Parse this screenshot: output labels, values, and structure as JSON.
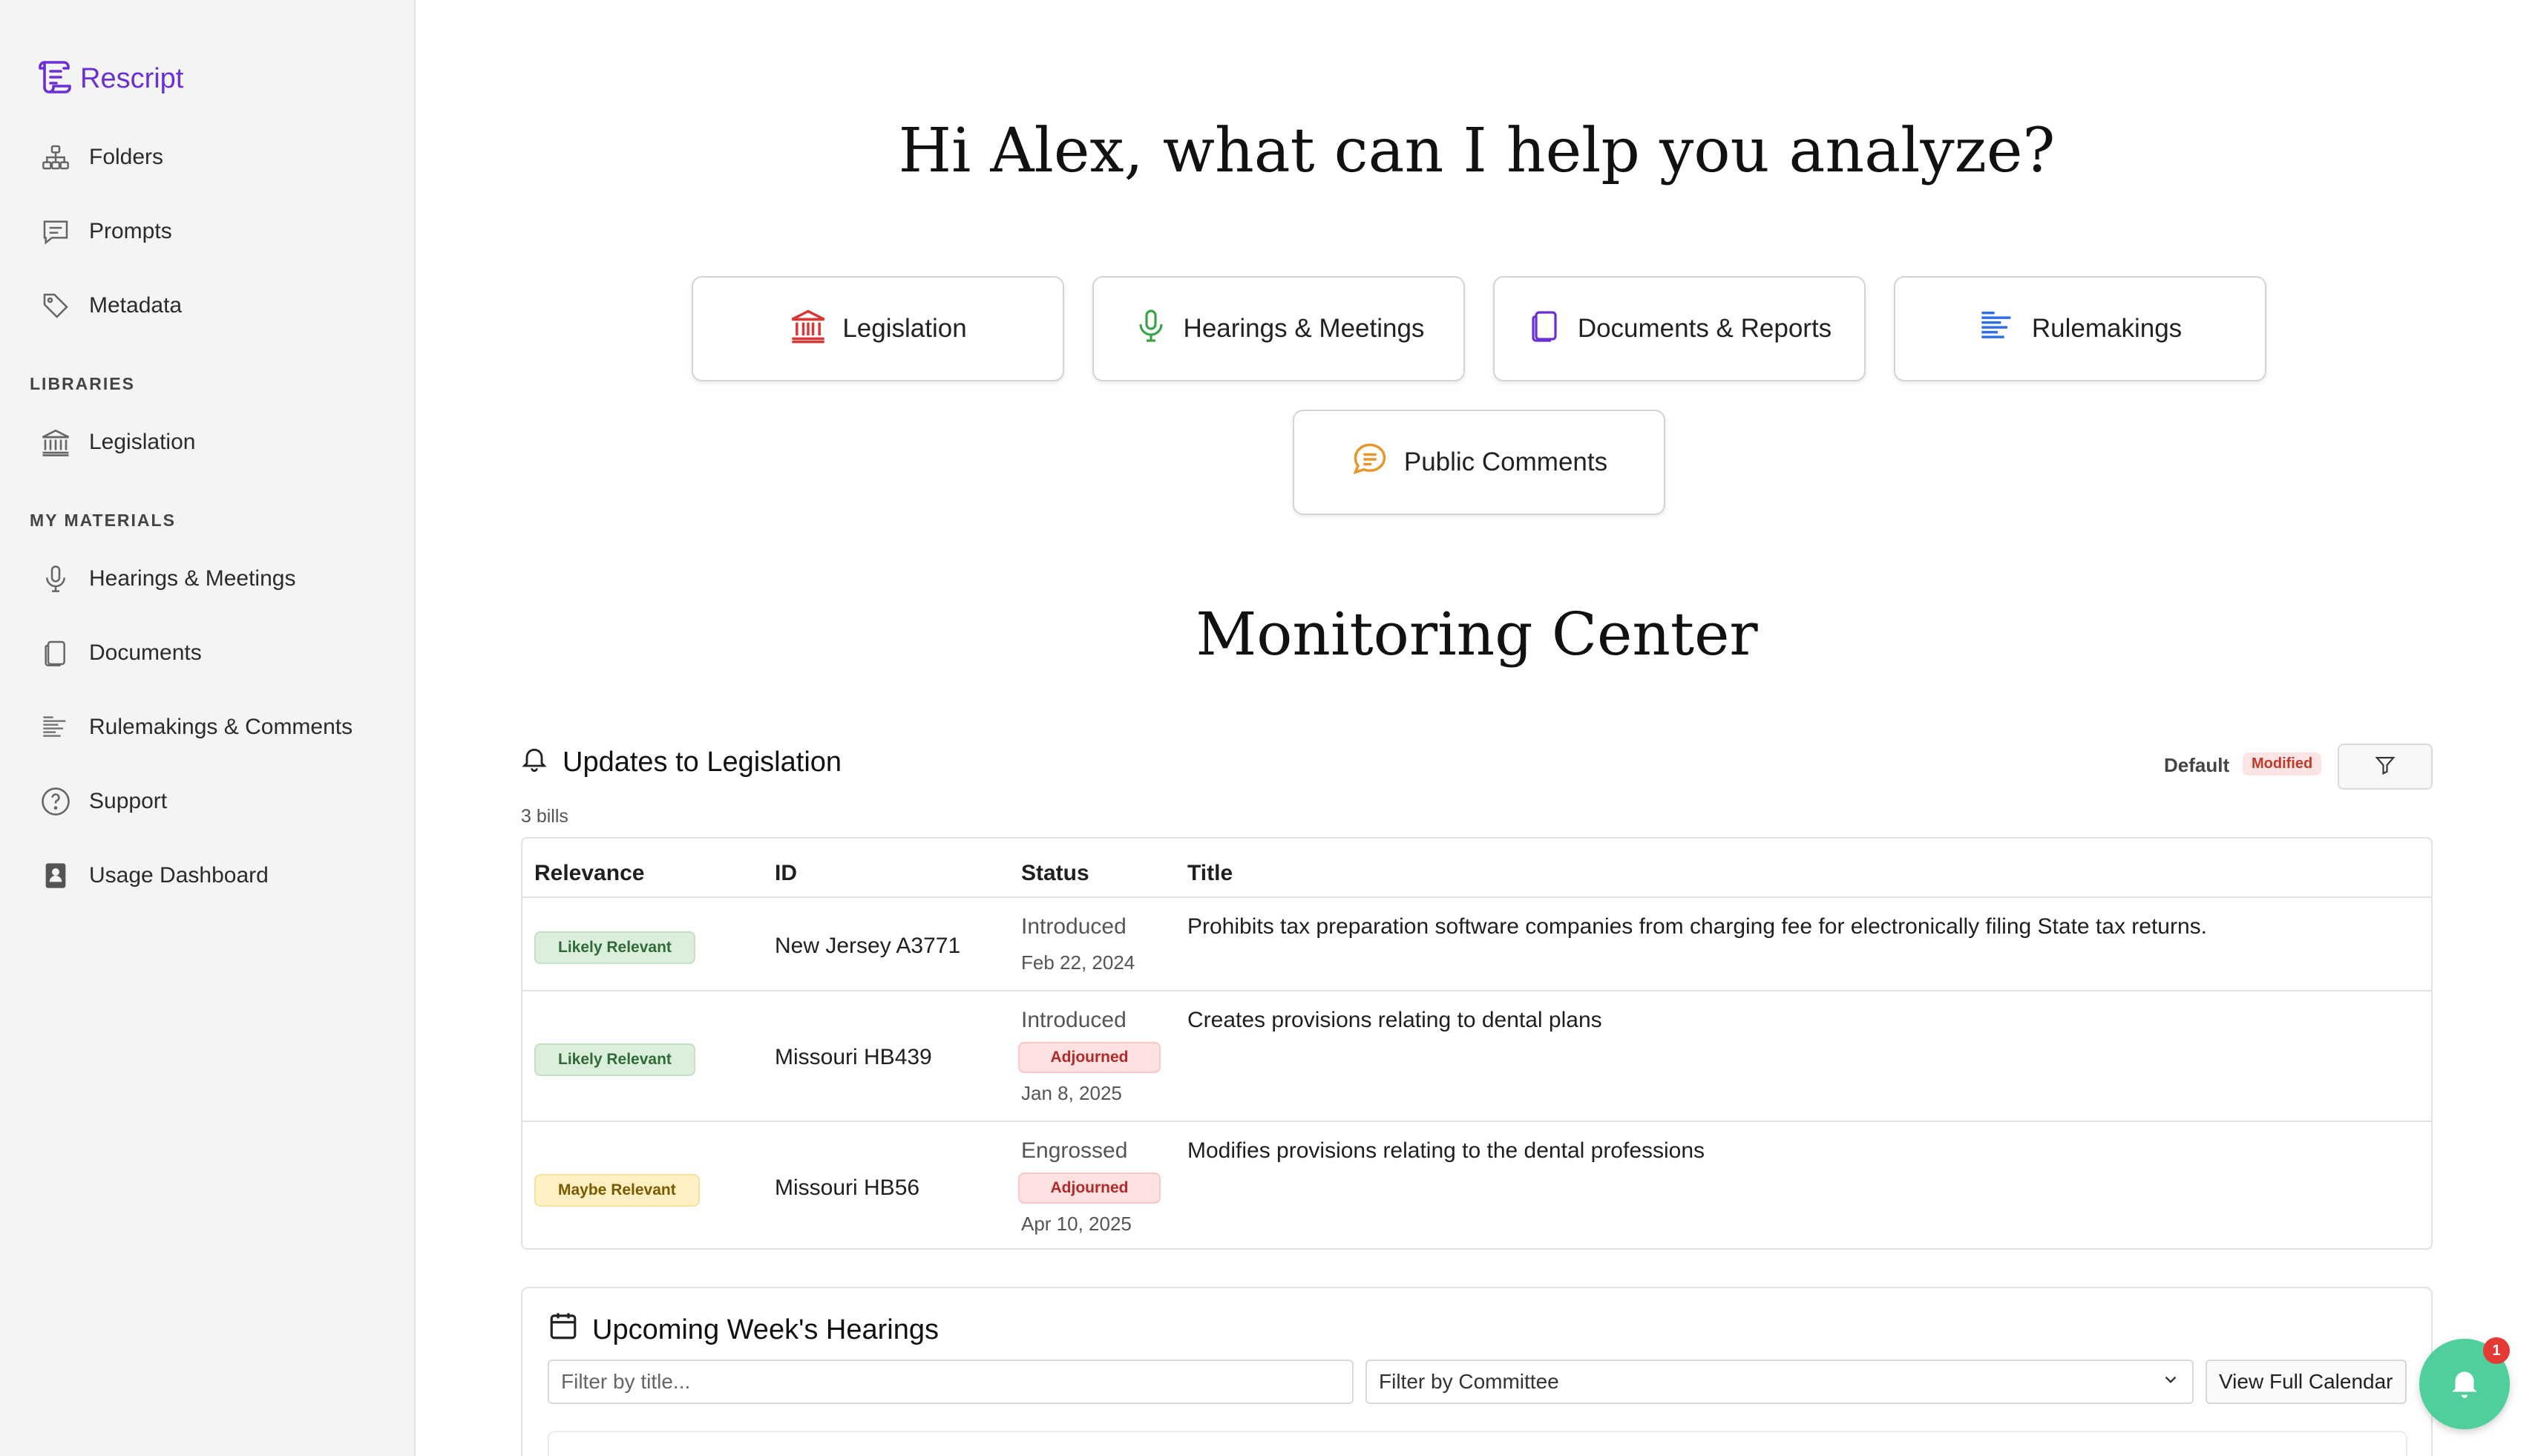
{
  "brand": {
    "name": "Rescript",
    "color": "#6b2fd6"
  },
  "sidebar": {
    "top_items": [
      {
        "label": "Folders",
        "icon": "folders-icon"
      },
      {
        "label": "Prompts",
        "icon": "prompts-icon"
      },
      {
        "label": "Metadata",
        "icon": "tag-icon"
      }
    ],
    "libraries_label": "LIBRARIES",
    "library_items": [
      {
        "label": "Legislation",
        "icon": "capitol-icon"
      }
    ],
    "materials_label": "MY MATERIALS",
    "material_items": [
      {
        "label": "Hearings & Meetings",
        "icon": "microphone-icon"
      },
      {
        "label": "Documents",
        "icon": "document-icon"
      },
      {
        "label": "Rulemakings & Comments",
        "icon": "rulemaking-icon"
      },
      {
        "label": "Support",
        "icon": "help-icon"
      },
      {
        "label": "Usage Dashboard",
        "icon": "dashboard-icon"
      }
    ]
  },
  "main": {
    "greeting": "Hi Alex, what can I help you analyze?",
    "quick_actions": [
      {
        "label": "Legislation",
        "icon": "capitol-icon",
        "color": "#d93636"
      },
      {
        "label": "Hearings & Meetings",
        "icon": "microphone-icon",
        "color": "#3aa34a"
      },
      {
        "label": "Documents & Reports",
        "icon": "document-icon",
        "color": "#6b2fd6"
      },
      {
        "label": "Rulemakings",
        "icon": "rulemaking-icon",
        "color": "#2f6fe0"
      },
      {
        "label": "Public Comments",
        "icon": "comment-icon",
        "color": "#e8952b"
      }
    ],
    "monitoring_title": "Monitoring Center",
    "updates": {
      "title": "Updates to Legislation",
      "count": "3 bills",
      "filter_default": "Default",
      "filter_modified": "Modified",
      "columns": [
        "Relevance",
        "ID",
        "Status",
        "Title"
      ],
      "rows": [
        {
          "relevance": "Likely Relevant",
          "id": "New Jersey A3771",
          "status": "Introduced",
          "adjourned": "",
          "date": "Feb 22, 2024",
          "title": "Prohibits tax preparation software companies from charging fee for electronically filing State tax returns."
        },
        {
          "relevance": "Likely Relevant",
          "id": "Missouri HB439",
          "status": "Introduced",
          "adjourned": "Adjourned",
          "date": "Jan 8, 2025",
          "title": "Creates provisions relating to dental plans"
        },
        {
          "relevance": "Maybe Relevant",
          "id": "Missouri HB56",
          "status": "Engrossed",
          "adjourned": "Adjourned",
          "date": "Apr 10, 2025",
          "title": "Modifies provisions relating to the dental professions"
        }
      ]
    },
    "hearings": {
      "title": "Upcoming Week's Hearings",
      "filter_title_placeholder": "Filter by title...",
      "filter_committee": "Filter by Committee",
      "view_calendar": "View Full Calendar"
    },
    "notifications": {
      "count": "1",
      "color": "#4fcf9c"
    }
  }
}
